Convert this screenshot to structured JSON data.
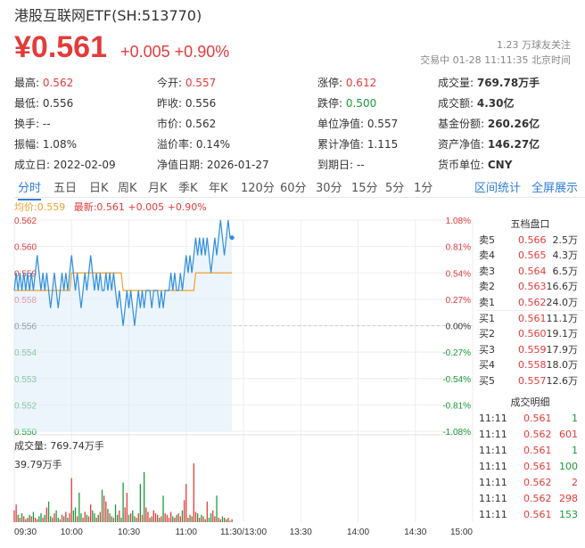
{
  "header": {
    "title": "港股互联网ETF(SH:513770)",
    "price": "¥0.561",
    "change": "+0.005",
    "change_pct": "+0.90%",
    "followers": "1.23 万球友关注",
    "status_time": "交易中 01-28 11:11:35 北京时间"
  },
  "quote": [
    [
      {
        "label": "最高:",
        "value": "0.562",
        "color": "red"
      },
      {
        "label": "今开:",
        "value": "0.557",
        "color": "red"
      },
      {
        "label": "涨停:",
        "value": "0.612",
        "color": "red"
      },
      {
        "label": "成交量:",
        "value": "769.78万手",
        "color": "bold"
      }
    ],
    [
      {
        "label": "最低:",
        "value": "0.556",
        "color": ""
      },
      {
        "label": "昨收:",
        "value": "0.556",
        "color": ""
      },
      {
        "label": "跌停:",
        "value": "0.500",
        "color": "green"
      },
      {
        "label": "成交额:",
        "value": "4.30亿",
        "color": "bold"
      }
    ],
    [
      {
        "label": "换手:",
        "value": "--",
        "color": ""
      },
      {
        "label": "市价:",
        "value": "0.562",
        "color": ""
      },
      {
        "label": "单位净值:",
        "value": "0.557",
        "color": ""
      },
      {
        "label": "基金份额:",
        "value": "260.26亿",
        "color": "bold"
      }
    ],
    [
      {
        "label": "振幅:",
        "value": "1.08%",
        "color": ""
      },
      {
        "label": "溢价率:",
        "value": "0.14%",
        "color": ""
      },
      {
        "label": "累计净值:",
        "value": "1.115",
        "color": ""
      },
      {
        "label": "资产净值:",
        "value": "146.27亿",
        "color": "bold"
      }
    ],
    [
      {
        "label": "成立日:",
        "value": "2022-02-09",
        "color": ""
      },
      {
        "label": "净值日期:",
        "value": "2026-01-27",
        "color": ""
      },
      {
        "label": "到期日:",
        "value": "--",
        "color": ""
      },
      {
        "label": "货币单位:",
        "value": "CNY",
        "color": "bold"
      }
    ]
  ],
  "tabs": [
    "分时",
    "五日",
    "日K",
    "周K",
    "月K",
    "季K",
    "年K",
    "120分",
    "60分",
    "30分",
    "15分",
    "5分",
    "1分"
  ],
  "tabs_right": [
    "区间统计",
    "全屏展示"
  ],
  "legend": {
    "avg": "均价:0.559",
    "latest": "最新:0.561 +0.005 +0.90%"
  },
  "order_book": {
    "title": "五档盘口",
    "asks": [
      {
        "label": "卖5",
        "price": "0.566",
        "vol": "2.5万"
      },
      {
        "label": "卖4",
        "price": "0.565",
        "vol": "4.3万"
      },
      {
        "label": "卖3",
        "price": "0.564",
        "vol": "6.5万"
      },
      {
        "label": "卖2",
        "price": "0.563",
        "vol": "16.6万"
      },
      {
        "label": "卖1",
        "price": "0.562",
        "vol": "24.0万"
      }
    ],
    "bids": [
      {
        "label": "买1",
        "price": "0.561",
        "vol": "11.1万"
      },
      {
        "label": "买2",
        "price": "0.560",
        "vol": "19.1万"
      },
      {
        "label": "买3",
        "price": "0.559",
        "vol": "17.9万"
      },
      {
        "label": "买4",
        "price": "0.558",
        "vol": "18.0万"
      },
      {
        "label": "买5",
        "price": "0.557",
        "vol": "12.6万"
      }
    ]
  },
  "trades": {
    "title": "成交明细",
    "rows": [
      {
        "time": "11:11",
        "price": "0.561",
        "vol": "1",
        "side": "green"
      },
      {
        "time": "11:11",
        "price": "0.562",
        "vol": "601",
        "side": "red"
      },
      {
        "time": "11:11",
        "price": "0.561",
        "vol": "1",
        "side": "green"
      },
      {
        "time": "11:11",
        "price": "0.561",
        "vol": "100",
        "side": "green"
      },
      {
        "time": "11:11",
        "price": "0.562",
        "vol": "2",
        "side": "red"
      },
      {
        "time": "11:11",
        "price": "0.562",
        "vol": "298",
        "side": "red"
      },
      {
        "time": "11:11",
        "price": "0.561",
        "vol": "153",
        "side": "green"
      }
    ]
  },
  "volume": {
    "label": "成交量: 769.74万手",
    "max_label": "39.79万手"
  },
  "colors": {
    "up": "#e33b3b",
    "down": "#1a9a3a",
    "line": "#2f8ee0",
    "avg": "#f0a030",
    "accent": "#2f7ed8"
  },
  "chart_data": {
    "type": "line",
    "prev_close": 0.556,
    "y_ticks": [
      "0.562",
      "0.560",
      "0.559",
      "0.558",
      "0.556",
      "0.554",
      "0.553",
      "0.552",
      "0.550"
    ],
    "y_pct_ticks": [
      "1.08%",
      "0.81%",
      "0.54%",
      "0.27%",
      "0.00%",
      "-0.27%",
      "-0.54%",
      "-0.81%",
      "-1.08%"
    ],
    "ylim": [
      0.55,
      0.562
    ],
    "x_ticks": [
      "09:30",
      "10:00",
      "10:30",
      "11:00",
      "11:30/13:00",
      "13:30",
      "14:00",
      "14:30",
      "15:00"
    ],
    "series": [
      {
        "values": [
          0.558,
          0.559,
          0.558,
          0.559,
          0.558,
          0.559,
          0.558,
          0.559,
          0.558,
          0.559,
          0.558,
          0.559,
          0.56,
          0.559,
          0.558,
          0.559,
          0.558,
          0.559,
          0.558,
          0.557,
          0.558,
          0.559,
          0.558,
          0.557,
          0.558,
          0.559,
          0.558,
          0.559,
          0.558,
          0.559,
          0.56,
          0.559,
          0.558,
          0.559,
          0.558,
          0.557,
          0.558,
          0.559,
          0.558,
          0.559,
          0.56,
          0.559,
          0.558,
          0.559,
          0.558,
          0.559,
          0.558,
          0.558,
          0.559,
          0.558,
          0.559,
          0.558,
          0.559,
          0.558,
          0.557,
          0.558,
          0.557,
          0.556,
          0.557,
          0.558,
          0.557,
          0.558,
          0.557,
          0.556,
          0.557,
          0.558,
          0.557,
          0.558,
          0.557,
          0.558,
          0.558,
          0.558,
          0.557,
          0.558,
          0.558,
          0.558,
          0.557,
          0.558,
          0.557,
          0.558,
          0.558,
          0.558,
          0.559,
          0.558,
          0.559,
          0.558,
          0.558,
          0.559,
          0.558,
          0.559,
          0.56,
          0.559,
          0.56,
          0.559,
          0.56,
          0.561,
          0.56,
          0.561,
          0.56,
          0.561,
          0.56,
          0.561,
          0.56,
          0.559,
          0.56,
          0.561,
          0.56,
          0.561,
          0.562,
          0.561,
          0.56,
          0.561,
          0.562,
          0.561,
          0.561
        ]
      },
      {
        "values": [
          0.558,
          0.558,
          0.558,
          0.558,
          0.558,
          0.558,
          0.558,
          0.558,
          0.558,
          0.558,
          0.558,
          0.558,
          0.558,
          0.558,
          0.558,
          0.558,
          0.558,
          0.558,
          0.558,
          0.558,
          0.558,
          0.558,
          0.558,
          0.558,
          0.558,
          0.558,
          0.558,
          0.558,
          0.558,
          0.558,
          0.559,
          0.559,
          0.559,
          0.559,
          0.559,
          0.559,
          0.559,
          0.559,
          0.559,
          0.559,
          0.559,
          0.559,
          0.559,
          0.559,
          0.559,
          0.559,
          0.559,
          0.559,
          0.559,
          0.559,
          0.559,
          0.559,
          0.559,
          0.559,
          0.559,
          0.559,
          0.559,
          0.558,
          0.558,
          0.558,
          0.558,
          0.558,
          0.558,
          0.558,
          0.558,
          0.558,
          0.558,
          0.558,
          0.558,
          0.558,
          0.558,
          0.558,
          0.558,
          0.558,
          0.558,
          0.558,
          0.558,
          0.558,
          0.558,
          0.558,
          0.558,
          0.558,
          0.558,
          0.558,
          0.558,
          0.558,
          0.558,
          0.558,
          0.558,
          0.558,
          0.558,
          0.558,
          0.558,
          0.558,
          0.558,
          0.559,
          0.559,
          0.559,
          0.559,
          0.559,
          0.559,
          0.559,
          0.559,
          0.559,
          0.559,
          0.559,
          0.559,
          0.559,
          0.559,
          0.559,
          0.559,
          0.559,
          0.559,
          0.559,
          0.559
        ]
      }
    ],
    "volume": [
      8,
      12,
      5,
      3,
      6,
      4,
      2,
      3,
      5,
      4,
      7,
      3,
      2,
      4,
      6,
      3,
      5,
      10,
      14,
      4,
      3,
      6,
      8,
      3,
      2,
      5,
      4,
      7,
      3,
      6,
      30,
      8,
      10,
      4,
      20,
      6,
      3,
      7,
      5,
      4,
      12,
      8,
      6,
      3,
      5,
      7,
      22,
      18,
      14,
      9,
      6,
      4,
      3,
      12,
      5,
      8,
      3,
      27,
      10,
      20,
      5,
      6,
      8,
      4,
      3,
      6,
      26,
      5,
      34,
      10,
      7,
      3,
      4,
      8,
      6,
      5,
      3,
      4,
      18,
      6,
      5,
      3,
      7,
      4,
      3,
      5,
      6,
      4,
      8,
      15,
      26,
      3,
      5,
      4,
      40,
      7,
      6,
      3,
      5,
      4,
      2,
      14,
      3,
      6,
      8,
      4,
      18,
      3,
      2,
      4,
      3,
      2,
      3,
      1,
      2
    ]
  }
}
